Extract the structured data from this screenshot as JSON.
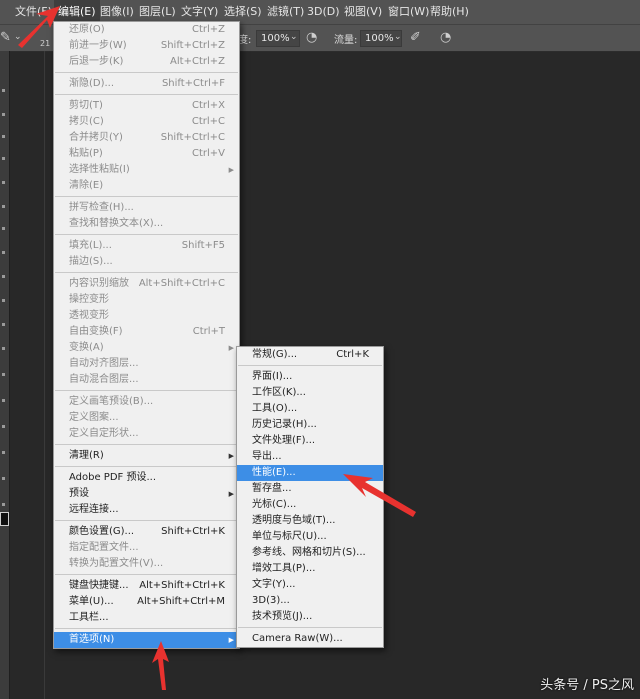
{
  "menubar": {
    "items": [
      "文件(F)",
      "编辑(E)",
      "图像(I)",
      "图层(L)",
      "文字(Y)",
      "选择(S)",
      "滤镜(T)",
      "3D(D)",
      "视图(V)",
      "窗口(W)",
      "帮助(H)"
    ],
    "active_index": 1
  },
  "options_bar": {
    "brush_size": "21",
    "opacity_label": "度:",
    "opacity_value": "100%",
    "flow_label": "流量:",
    "flow_value": "100%"
  },
  "edit_menu": {
    "items": [
      {
        "label": "还原(O)",
        "shortcut": "Ctrl+Z",
        "disabled": true
      },
      {
        "label": "前进一步(W)",
        "shortcut": "Shift+Ctrl+Z",
        "disabled": true
      },
      {
        "label": "后退一步(K)",
        "shortcut": "Alt+Ctrl+Z",
        "disabled": true
      },
      {
        "sep": true
      },
      {
        "label": "渐隐(D)...",
        "shortcut": "Shift+Ctrl+F",
        "disabled": true
      },
      {
        "sep": true
      },
      {
        "label": "剪切(T)",
        "shortcut": "Ctrl+X",
        "disabled": true
      },
      {
        "label": "拷贝(C)",
        "shortcut": "Ctrl+C",
        "disabled": true
      },
      {
        "label": "合并拷贝(Y)",
        "shortcut": "Shift+Ctrl+C",
        "disabled": true
      },
      {
        "label": "粘贴(P)",
        "shortcut": "Ctrl+V",
        "disabled": true
      },
      {
        "label": "选择性粘贴(I)",
        "shortcut": "",
        "disabled": true,
        "submenu": true
      },
      {
        "label": "清除(E)",
        "shortcut": "",
        "disabled": true
      },
      {
        "sep": true
      },
      {
        "label": "拼写检查(H)...",
        "shortcut": "",
        "disabled": true
      },
      {
        "label": "查找和替换文本(X)...",
        "shortcut": "",
        "disabled": true
      },
      {
        "sep": true
      },
      {
        "label": "填充(L)...",
        "shortcut": "Shift+F5",
        "disabled": true
      },
      {
        "label": "描边(S)...",
        "shortcut": "",
        "disabled": true
      },
      {
        "sep": true
      },
      {
        "label": "内容识别缩放",
        "shortcut": "Alt+Shift+Ctrl+C",
        "disabled": true
      },
      {
        "label": "操控变形",
        "shortcut": "",
        "disabled": true
      },
      {
        "label": "透视变形",
        "shortcut": "",
        "disabled": true
      },
      {
        "label": "自由变换(F)",
        "shortcut": "Ctrl+T",
        "disabled": true
      },
      {
        "label": "变换(A)",
        "shortcut": "",
        "disabled": true,
        "submenu": true
      },
      {
        "label": "自动对齐图层...",
        "shortcut": "",
        "disabled": true
      },
      {
        "label": "自动混合图层...",
        "shortcut": "",
        "disabled": true
      },
      {
        "sep": true
      },
      {
        "label": "定义画笔预设(B)...",
        "shortcut": "",
        "disabled": true
      },
      {
        "label": "定义图案...",
        "shortcut": "",
        "disabled": true
      },
      {
        "label": "定义自定形状...",
        "shortcut": "",
        "disabled": true
      },
      {
        "sep": true
      },
      {
        "label": "清理(R)",
        "shortcut": "",
        "disabled": false,
        "submenu": true
      },
      {
        "sep": true
      },
      {
        "label": "Adobe PDF 预设...",
        "shortcut": "",
        "disabled": false
      },
      {
        "label": "预设",
        "shortcut": "",
        "disabled": false,
        "submenu": true
      },
      {
        "label": "远程连接...",
        "shortcut": "",
        "disabled": false
      },
      {
        "sep": true
      },
      {
        "label": "颜色设置(G)...",
        "shortcut": "Shift+Ctrl+K",
        "disabled": false
      },
      {
        "label": "指定配置文件...",
        "shortcut": "",
        "disabled": true
      },
      {
        "label": "转换为配置文件(V)...",
        "shortcut": "",
        "disabled": true
      },
      {
        "sep": true
      },
      {
        "label": "键盘快捷键...",
        "shortcut": "Alt+Shift+Ctrl+K",
        "disabled": false
      },
      {
        "label": "菜单(U)...",
        "shortcut": "Alt+Shift+Ctrl+M",
        "disabled": false
      },
      {
        "label": "工具栏...",
        "shortcut": "",
        "disabled": false
      },
      {
        "sep": true
      },
      {
        "label": "首选项(N)",
        "shortcut": "",
        "disabled": false,
        "submenu": true,
        "highlighted": true
      }
    ]
  },
  "prefs_menu": {
    "items": [
      {
        "label": "常规(G)...",
        "shortcut": "Ctrl+K"
      },
      {
        "sep": true
      },
      {
        "label": "界面(I)...",
        "shortcut": ""
      },
      {
        "label": "工作区(K)...",
        "shortcut": ""
      },
      {
        "label": "工具(O)...",
        "shortcut": ""
      },
      {
        "label": "历史记录(H)...",
        "shortcut": ""
      },
      {
        "label": "文件处理(F)...",
        "shortcut": ""
      },
      {
        "label": "导出...",
        "shortcut": ""
      },
      {
        "label": "性能(E)...",
        "shortcut": "",
        "highlighted": true
      },
      {
        "label": "暂存盘...",
        "shortcut": ""
      },
      {
        "label": "光标(C)...",
        "shortcut": ""
      },
      {
        "label": "透明度与色域(T)...",
        "shortcut": ""
      },
      {
        "label": "单位与标尺(U)...",
        "shortcut": ""
      },
      {
        "label": "参考线、网格和切片(S)...",
        "shortcut": ""
      },
      {
        "label": "增效工具(P)...",
        "shortcut": ""
      },
      {
        "label": "文字(Y)...",
        "shortcut": ""
      },
      {
        "label": "3D(3)...",
        "shortcut": ""
      },
      {
        "label": "技术预览(J)...",
        "shortcut": ""
      },
      {
        "sep": true
      },
      {
        "label": "Camera Raw(W)...",
        "shortcut": ""
      }
    ]
  },
  "watermark": "头条号 / PS之风",
  "colors": {
    "highlight": "#3d8ee6",
    "annotation_arrow": "#e8322f",
    "canvas": "#282828",
    "menubar": "#535353"
  }
}
